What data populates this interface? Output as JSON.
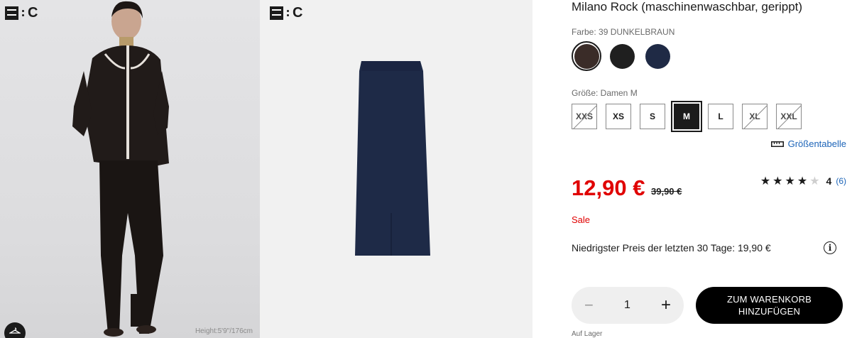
{
  "gallery": {
    "logo_letter": "C",
    "height_caption": "Height:5'9\"/176cm",
    "model_alt": "model wearing dark brown ribbed skirt",
    "skirt_alt": "navy ribbed pencil skirt"
  },
  "product": {
    "title": "Milano Rock (maschinenwaschbar, gerippt)",
    "color_label": "Farbe: 39 DUNKELBRAUN",
    "colors": [
      {
        "name": "DUNKELBRAUN",
        "hex": "#3a2c28",
        "selected": true
      },
      {
        "name": "SCHWARZ",
        "hex": "#1f1f1f",
        "selected": false
      },
      {
        "name": "NAVY",
        "hex": "#1f2a45",
        "selected": false
      }
    ],
    "size_label": "Größe: Damen M",
    "sizes": [
      {
        "label": "XXS",
        "state": "unavailable"
      },
      {
        "label": "XS",
        "state": "available"
      },
      {
        "label": "S",
        "state": "available"
      },
      {
        "label": "M",
        "state": "selected"
      },
      {
        "label": "L",
        "state": "available"
      },
      {
        "label": "XL",
        "state": "unavailable"
      },
      {
        "label": "XXL",
        "state": "unavailable"
      }
    ],
    "size_chart_label": "Größentabelle",
    "price": "12,90 €",
    "old_price": "39,90 €",
    "rating": {
      "stars_filled": 4,
      "stars_total": 5,
      "score": "4",
      "count": "(6)"
    },
    "sale_label": "Sale",
    "lowest_price_text": "Niedrigster Preis der letzten 30 Tage: 19,90 €",
    "quantity": "1",
    "add_to_cart_line1": "ZUM WARENKORB",
    "add_to_cart_line2": "HINZUFÜGEN",
    "stock_text": "Auf Lager"
  },
  "icons": {
    "minus": "−",
    "plus": "+",
    "info": "i",
    "star_filled": "★",
    "star_empty": "★"
  }
}
